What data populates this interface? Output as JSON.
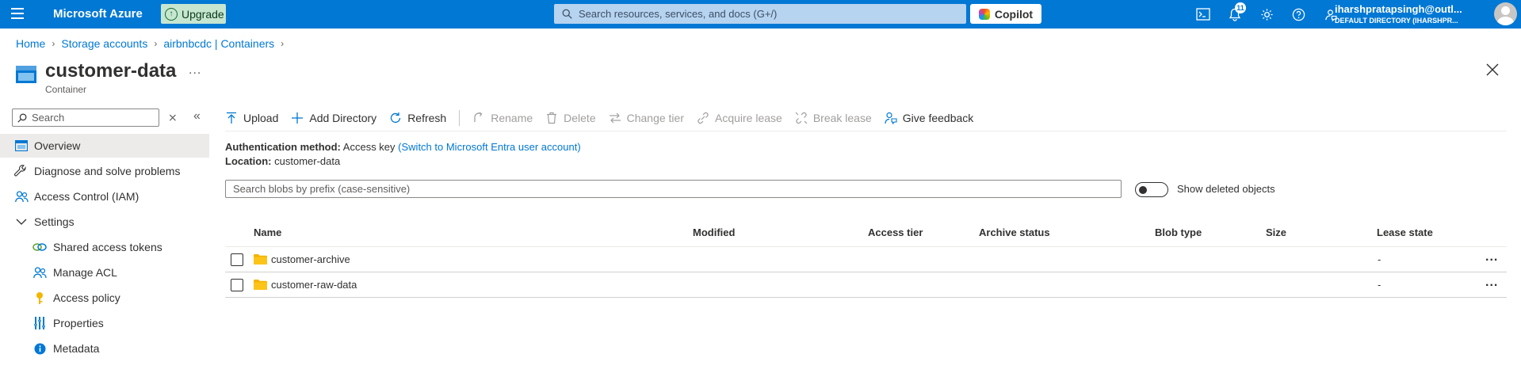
{
  "topbar": {
    "brand": "Microsoft Azure",
    "upgrade_label": "Upgrade",
    "search_placeholder": "Search resources, services, and docs (G+/)",
    "copilot_label": "Copilot",
    "notification_count": "11",
    "user_email": "iharshpratapsingh@outl...",
    "user_directory": "DEFAULT DIRECTORY (IHARSHPR..."
  },
  "breadcrumb": [
    "Home",
    "Storage accounts",
    "airbnbcdc | Containers"
  ],
  "header": {
    "title": "customer-data",
    "subtitle": "Container",
    "more": "..."
  },
  "nav": {
    "search_placeholder": "Search",
    "items": [
      {
        "label": "Overview",
        "icon": "overview-icon",
        "active": true
      },
      {
        "label": "Diagnose and solve problems",
        "icon": "wrench-icon"
      },
      {
        "label": "Access Control (IAM)",
        "icon": "people-icon"
      },
      {
        "label": "Settings",
        "icon": "chevron-down-icon"
      },
      {
        "label": "Shared access tokens",
        "icon": "link-icon"
      },
      {
        "label": "Manage ACL",
        "icon": "people-icon"
      },
      {
        "label": "Access policy",
        "icon": "key-icon"
      },
      {
        "label": "Properties",
        "icon": "properties-icon"
      },
      {
        "label": "Metadata",
        "icon": "info-icon"
      }
    ]
  },
  "toolbar": {
    "upload": "Upload",
    "add_directory": "Add Directory",
    "refresh": "Refresh",
    "rename": "Rename",
    "delete": "Delete",
    "change_tier": "Change tier",
    "acquire_lease": "Acquire lease",
    "break_lease": "Break lease",
    "give_feedback": "Give feedback"
  },
  "info": {
    "auth_label": "Authentication method:",
    "auth_value": "Access key",
    "auth_link": "(Switch to Microsoft Entra user account)",
    "location_label": "Location:",
    "location_value": "customer-data"
  },
  "blob_search_placeholder": "Search blobs by prefix (case-sensitive)",
  "show_deleted_label": "Show deleted objects",
  "table": {
    "columns": [
      "Name",
      "Modified",
      "Access tier",
      "Archive status",
      "Blob type",
      "Size",
      "Lease state"
    ],
    "rows": [
      {
        "name": "customer-archive",
        "lease_state": "-"
      },
      {
        "name": "customer-raw-data",
        "lease_state": "-"
      }
    ],
    "row_more": "..."
  }
}
